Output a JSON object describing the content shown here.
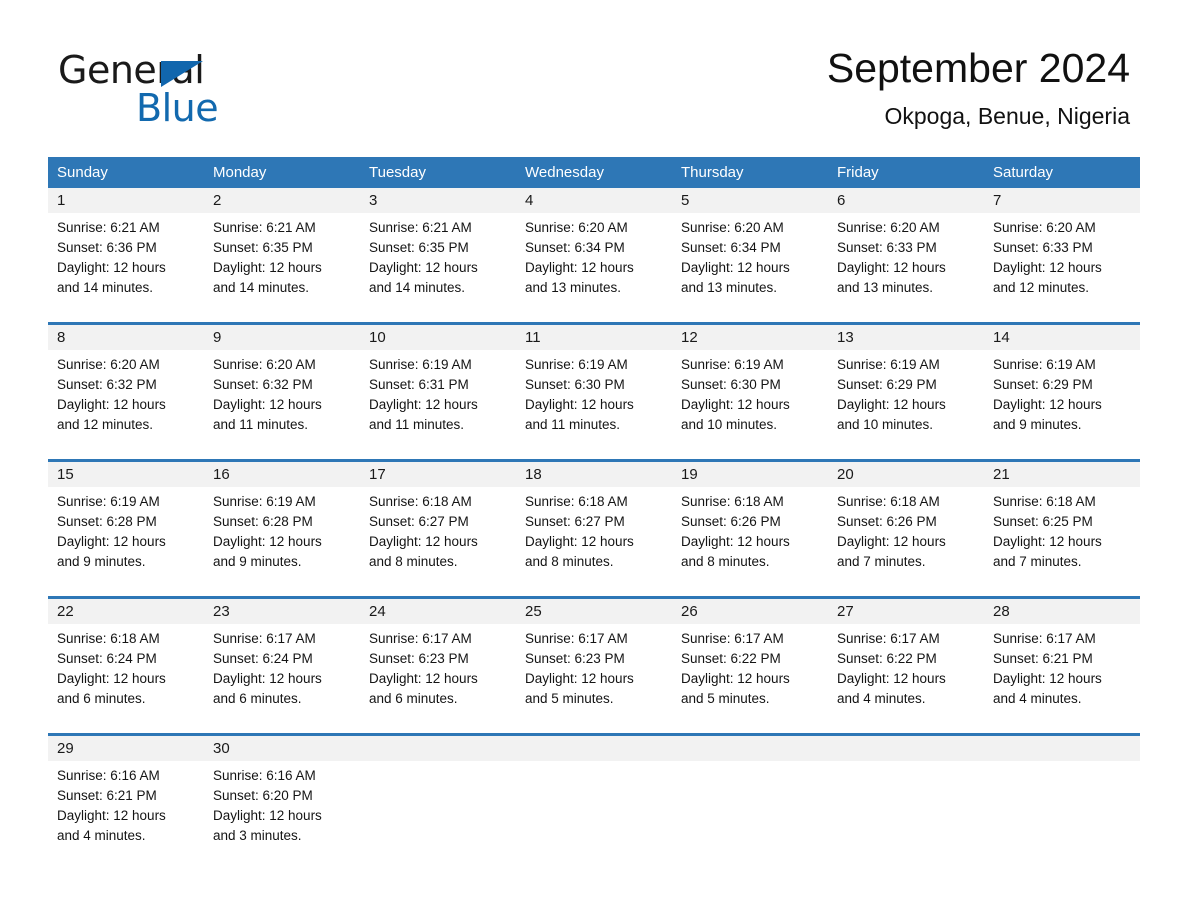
{
  "brand": {
    "name_part1": "General",
    "name_part2": "Blue",
    "triangle_color": "#1166ad",
    "blue_color": "#1269ae"
  },
  "header": {
    "title": "September 2024",
    "subtitle": "Okpoga, Benue, Nigeria"
  },
  "theme": {
    "header_bg": "#2e77b6",
    "day_band_bg": "#f2f2f2",
    "row_rule": "#2e77b6"
  },
  "weekdays": [
    "Sunday",
    "Monday",
    "Tuesday",
    "Wednesday",
    "Thursday",
    "Friday",
    "Saturday"
  ],
  "weeks": [
    [
      {
        "day": "1",
        "sunrise": "Sunrise: 6:21 AM",
        "sunset": "Sunset: 6:36 PM",
        "daylight_line1": "Daylight: 12 hours",
        "daylight_line2": "and 14 minutes."
      },
      {
        "day": "2",
        "sunrise": "Sunrise: 6:21 AM",
        "sunset": "Sunset: 6:35 PM",
        "daylight_line1": "Daylight: 12 hours",
        "daylight_line2": "and 14 minutes."
      },
      {
        "day": "3",
        "sunrise": "Sunrise: 6:21 AM",
        "sunset": "Sunset: 6:35 PM",
        "daylight_line1": "Daylight: 12 hours",
        "daylight_line2": "and 14 minutes."
      },
      {
        "day": "4",
        "sunrise": "Sunrise: 6:20 AM",
        "sunset": "Sunset: 6:34 PM",
        "daylight_line1": "Daylight: 12 hours",
        "daylight_line2": "and 13 minutes."
      },
      {
        "day": "5",
        "sunrise": "Sunrise: 6:20 AM",
        "sunset": "Sunset: 6:34 PM",
        "daylight_line1": "Daylight: 12 hours",
        "daylight_line2": "and 13 minutes."
      },
      {
        "day": "6",
        "sunrise": "Sunrise: 6:20 AM",
        "sunset": "Sunset: 6:33 PM",
        "daylight_line1": "Daylight: 12 hours",
        "daylight_line2": "and 13 minutes."
      },
      {
        "day": "7",
        "sunrise": "Sunrise: 6:20 AM",
        "sunset": "Sunset: 6:33 PM",
        "daylight_line1": "Daylight: 12 hours",
        "daylight_line2": "and 12 minutes."
      }
    ],
    [
      {
        "day": "8",
        "sunrise": "Sunrise: 6:20 AM",
        "sunset": "Sunset: 6:32 PM",
        "daylight_line1": "Daylight: 12 hours",
        "daylight_line2": "and 12 minutes."
      },
      {
        "day": "9",
        "sunrise": "Sunrise: 6:20 AM",
        "sunset": "Sunset: 6:32 PM",
        "daylight_line1": "Daylight: 12 hours",
        "daylight_line2": "and 11 minutes."
      },
      {
        "day": "10",
        "sunrise": "Sunrise: 6:19 AM",
        "sunset": "Sunset: 6:31 PM",
        "daylight_line1": "Daylight: 12 hours",
        "daylight_line2": "and 11 minutes."
      },
      {
        "day": "11",
        "sunrise": "Sunrise: 6:19 AM",
        "sunset": "Sunset: 6:30 PM",
        "daylight_line1": "Daylight: 12 hours",
        "daylight_line2": "and 11 minutes."
      },
      {
        "day": "12",
        "sunrise": "Sunrise: 6:19 AM",
        "sunset": "Sunset: 6:30 PM",
        "daylight_line1": "Daylight: 12 hours",
        "daylight_line2": "and 10 minutes."
      },
      {
        "day": "13",
        "sunrise": "Sunrise: 6:19 AM",
        "sunset": "Sunset: 6:29 PM",
        "daylight_line1": "Daylight: 12 hours",
        "daylight_line2": "and 10 minutes."
      },
      {
        "day": "14",
        "sunrise": "Sunrise: 6:19 AM",
        "sunset": "Sunset: 6:29 PM",
        "daylight_line1": "Daylight: 12 hours",
        "daylight_line2": "and 9 minutes."
      }
    ],
    [
      {
        "day": "15",
        "sunrise": "Sunrise: 6:19 AM",
        "sunset": "Sunset: 6:28 PM",
        "daylight_line1": "Daylight: 12 hours",
        "daylight_line2": "and 9 minutes."
      },
      {
        "day": "16",
        "sunrise": "Sunrise: 6:19 AM",
        "sunset": "Sunset: 6:28 PM",
        "daylight_line1": "Daylight: 12 hours",
        "daylight_line2": "and 9 minutes."
      },
      {
        "day": "17",
        "sunrise": "Sunrise: 6:18 AM",
        "sunset": "Sunset: 6:27 PM",
        "daylight_line1": "Daylight: 12 hours",
        "daylight_line2": "and 8 minutes."
      },
      {
        "day": "18",
        "sunrise": "Sunrise: 6:18 AM",
        "sunset": "Sunset: 6:27 PM",
        "daylight_line1": "Daylight: 12 hours",
        "daylight_line2": "and 8 minutes."
      },
      {
        "day": "19",
        "sunrise": "Sunrise: 6:18 AM",
        "sunset": "Sunset: 6:26 PM",
        "daylight_line1": "Daylight: 12 hours",
        "daylight_line2": "and 8 minutes."
      },
      {
        "day": "20",
        "sunrise": "Sunrise: 6:18 AM",
        "sunset": "Sunset: 6:26 PM",
        "daylight_line1": "Daylight: 12 hours",
        "daylight_line2": "and 7 minutes."
      },
      {
        "day": "21",
        "sunrise": "Sunrise: 6:18 AM",
        "sunset": "Sunset: 6:25 PM",
        "daylight_line1": "Daylight: 12 hours",
        "daylight_line2": "and 7 minutes."
      }
    ],
    [
      {
        "day": "22",
        "sunrise": "Sunrise: 6:18 AM",
        "sunset": "Sunset: 6:24 PM",
        "daylight_line1": "Daylight: 12 hours",
        "daylight_line2": "and 6 minutes."
      },
      {
        "day": "23",
        "sunrise": "Sunrise: 6:17 AM",
        "sunset": "Sunset: 6:24 PM",
        "daylight_line1": "Daylight: 12 hours",
        "daylight_line2": "and 6 minutes."
      },
      {
        "day": "24",
        "sunrise": "Sunrise: 6:17 AM",
        "sunset": "Sunset: 6:23 PM",
        "daylight_line1": "Daylight: 12 hours",
        "daylight_line2": "and 6 minutes."
      },
      {
        "day": "25",
        "sunrise": "Sunrise: 6:17 AM",
        "sunset": "Sunset: 6:23 PM",
        "daylight_line1": "Daylight: 12 hours",
        "daylight_line2": "and 5 minutes."
      },
      {
        "day": "26",
        "sunrise": "Sunrise: 6:17 AM",
        "sunset": "Sunset: 6:22 PM",
        "daylight_line1": "Daylight: 12 hours",
        "daylight_line2": "and 5 minutes."
      },
      {
        "day": "27",
        "sunrise": "Sunrise: 6:17 AM",
        "sunset": "Sunset: 6:22 PM",
        "daylight_line1": "Daylight: 12 hours",
        "daylight_line2": "and 4 minutes."
      },
      {
        "day": "28",
        "sunrise": "Sunrise: 6:17 AM",
        "sunset": "Sunset: 6:21 PM",
        "daylight_line1": "Daylight: 12 hours",
        "daylight_line2": "and 4 minutes."
      }
    ],
    [
      {
        "day": "29",
        "sunrise": "Sunrise: 6:16 AM",
        "sunset": "Sunset: 6:21 PM",
        "daylight_line1": "Daylight: 12 hours",
        "daylight_line2": "and 4 minutes."
      },
      {
        "day": "30",
        "sunrise": "Sunrise: 6:16 AM",
        "sunset": "Sunset: 6:20 PM",
        "daylight_line1": "Daylight: 12 hours",
        "daylight_line2": "and 3 minutes."
      },
      {
        "day": "",
        "sunrise": "",
        "sunset": "",
        "daylight_line1": "",
        "daylight_line2": ""
      },
      {
        "day": "",
        "sunrise": "",
        "sunset": "",
        "daylight_line1": "",
        "daylight_line2": ""
      },
      {
        "day": "",
        "sunrise": "",
        "sunset": "",
        "daylight_line1": "",
        "daylight_line2": ""
      },
      {
        "day": "",
        "sunrise": "",
        "sunset": "",
        "daylight_line1": "",
        "daylight_line2": ""
      },
      {
        "day": "",
        "sunrise": "",
        "sunset": "",
        "daylight_line1": "",
        "daylight_line2": ""
      }
    ]
  ]
}
